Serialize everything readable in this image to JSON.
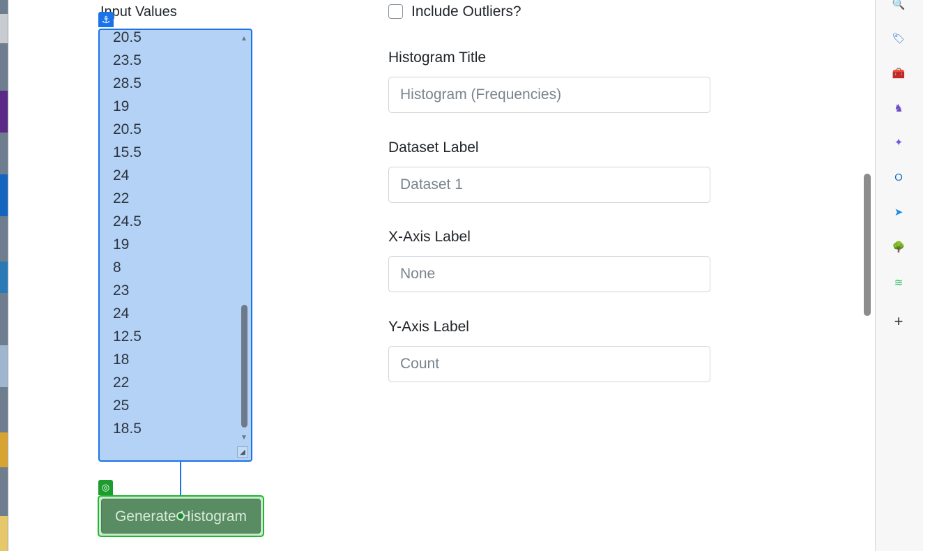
{
  "form": {
    "input_values_label": "Input Values",
    "input_values": [
      "20.5",
      "23.5",
      "28.5",
      "19",
      "20.5",
      "15.5",
      "24",
      "22",
      "24.5",
      "19",
      "8",
      "23",
      "24",
      "12.5",
      "18",
      "22",
      "25",
      "18.5"
    ],
    "include_outliers_label": "Include Outliers?",
    "histogram_title_label": "Histogram Title",
    "histogram_title_placeholder": "Histogram (Frequencies)",
    "dataset_label_label": "Dataset Label",
    "dataset_label_placeholder": "Dataset 1",
    "x_axis_label_label": "X-Axis Label",
    "x_axis_label_placeholder": "None",
    "y_axis_label_label": "Y-Axis Label",
    "y_axis_label_placeholder": "Count",
    "generate_button_label": "Generate Histogram"
  },
  "overlay": {
    "anchor_icon": "⚓",
    "target_icon": "◎"
  },
  "sidebar": {
    "icons": [
      {
        "name": "search-icon",
        "glyph": "🔍"
      },
      {
        "name": "tag-icon",
        "glyph": "🏷"
      },
      {
        "name": "toolbox-icon",
        "glyph": "🧰"
      },
      {
        "name": "chess-icon",
        "glyph": "♞"
      },
      {
        "name": "copilot-icon",
        "glyph": "✦"
      },
      {
        "name": "outlook-icon",
        "glyph": "O"
      },
      {
        "name": "send-icon",
        "glyph": "➤"
      },
      {
        "name": "tree-icon",
        "glyph": "🌳"
      },
      {
        "name": "spotify-icon",
        "glyph": "≋"
      },
      {
        "name": "add-icon",
        "glyph": "+"
      }
    ]
  },
  "colors": {
    "accent_blue": "#1a73e8",
    "accent_green": "#1fb82e",
    "button_green": "#5a8c63"
  }
}
